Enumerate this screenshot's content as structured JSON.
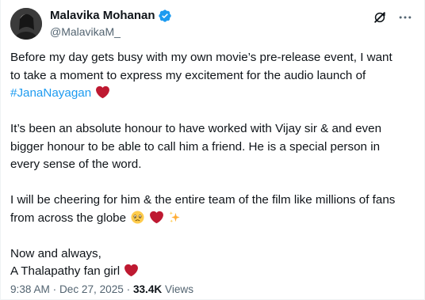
{
  "post": {
    "author": {
      "display_name": "Malavika Mohanan",
      "handle": "@MalavikaM_",
      "verified": true,
      "verified_color": "#1d9bf0"
    },
    "paragraphs": [
      {
        "line1": "Before my day gets busy with my own movie’s pre-release event, I want",
        "line2": "to take a moment to express my excitement for the audio launch of",
        "hashtag": "#JanaNayagan",
        "emoji": "red-heart"
      },
      {
        "text": "It’s been an absolute honour to have worked with Vijay sir & and even bigger honour to be able to call him a friend. He is a special person in every sense of the word."
      },
      {
        "text": "I will be cheering for him & the entire team of the film like millions of fans from across the globe",
        "emojis": [
          "holding-back-tears",
          "red-heart",
          "sparkles"
        ]
      },
      {
        "line1": "Now and always,",
        "line2": "A Thalapathy fan girl",
        "emoji": "red-heart"
      }
    ],
    "meta": {
      "time": "9:38 AM",
      "separator1": " · ",
      "date": "Dec 27, 2025",
      "separator2": " · ",
      "views_count": "33.4K",
      "views_label": " Views"
    },
    "icons": {
      "grok": "grok-icon",
      "more": "more-icon"
    },
    "colors": {
      "text": "#0f1419",
      "secondary": "#536471",
      "link": "#1d9bf0",
      "heart": "#be1931"
    }
  }
}
